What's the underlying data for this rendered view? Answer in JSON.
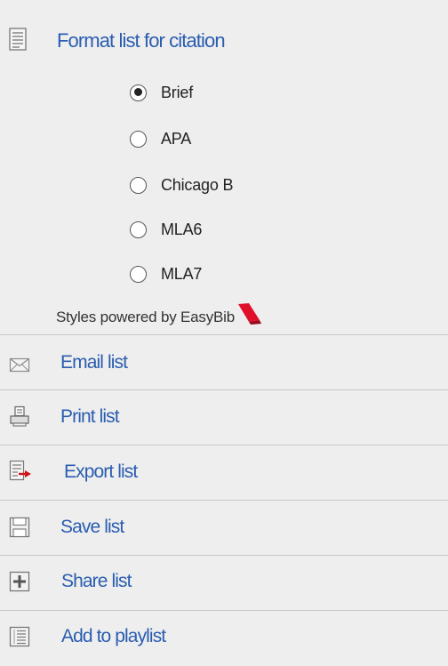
{
  "format": {
    "title": "Format list for citation",
    "options": [
      {
        "label": "Brief",
        "checked": true
      },
      {
        "label": "APA",
        "checked": false
      },
      {
        "label": "Chicago B",
        "checked": false
      },
      {
        "label": "MLA6",
        "checked": false
      },
      {
        "label": "MLA7",
        "checked": false
      }
    ],
    "powered_by": "Styles powered by EasyBib"
  },
  "actions": [
    {
      "label": "Email list",
      "icon": "envelope-icon"
    },
    {
      "label": "Print list",
      "icon": "printer-icon"
    },
    {
      "label": "Export list",
      "icon": "export-icon"
    },
    {
      "label": "Save list",
      "icon": "save-icon"
    },
    {
      "label": "Share list",
      "icon": "plus-box-icon"
    },
    {
      "label": "Add to playlist",
      "icon": "playlist-icon"
    }
  ],
  "colors": {
    "link": "#2a5db0",
    "background": "#eeeeee",
    "easybib_red": "#e0102a"
  }
}
